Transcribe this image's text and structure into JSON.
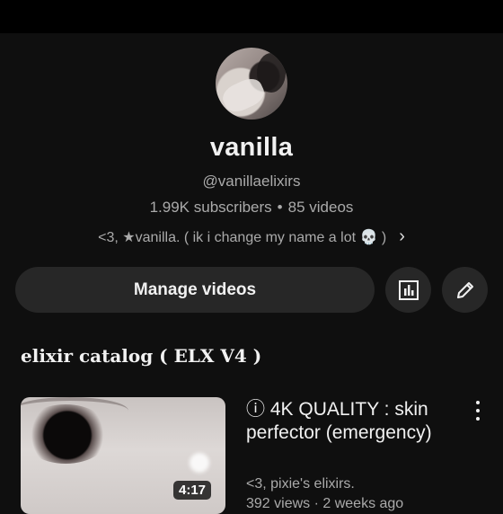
{
  "channel": {
    "name": "vanilla",
    "handle": "@vanillaelixirs",
    "subscribers": "1.99K subscribers",
    "separator": "•",
    "videos": "85 videos",
    "description": "<3, ★vanilla. ( ik i change my name a lot 💀 )",
    "description_more_icon": "chevron-right-icon"
  },
  "actions": {
    "manage_label": "Manage videos",
    "analytics_icon": "bar-chart-icon",
    "edit_icon": "pencil-icon"
  },
  "section": {
    "title": "elixir catalog ( ELX V4 )"
  },
  "video": {
    "title": "ⓘ 4K QUALITY : skin perfector (emergency)",
    "channel": "<3, pixie's elixirs.",
    "meta": "392 views · 2 weeks ago",
    "duration": "4:17",
    "menu_icon": "more-vertical-icon"
  },
  "colors": {
    "background": "#0f0f0f",
    "button_bg": "#272727",
    "secondary_text": "#aaaaaa"
  }
}
